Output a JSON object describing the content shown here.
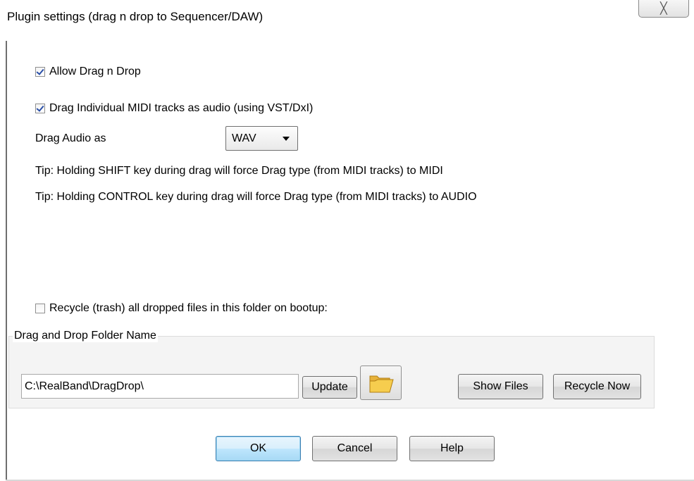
{
  "window": {
    "title": "Plugin settings (drag n drop to Sequencer/DAW)",
    "close_glyph": "╳"
  },
  "options": {
    "allow_drag": {
      "label": "Allow Drag n Drop",
      "checked": true
    },
    "drag_midi_audio": {
      "label": "Drag Individual MIDI tracks as audio (using VST/DxI)",
      "checked": true
    },
    "drag_audio_as_label": "Drag Audio as",
    "drag_audio_as_value": "WAV",
    "tip_shift": "Tip: Holding SHIFT key during drag will force Drag type (from MIDI tracks) to MIDI",
    "tip_control": "Tip: Holding CONTROL key during drag will force Drag type (from MIDI tracks) to AUDIO",
    "recycle": {
      "label": "Recycle (trash) all dropped files in this folder on bootup:",
      "checked": false
    }
  },
  "folder_group": {
    "title": "Drag and Drop Folder Name",
    "path_value": "C:\\RealBand\\DragDrop\\",
    "update_label": "Update",
    "show_files_label": "Show Files",
    "recycle_now_label": "Recycle Now"
  },
  "footer": {
    "ok_label": "OK",
    "cancel_label": "Cancel",
    "help_label": "Help"
  },
  "icons": {
    "folder": "folder-icon",
    "close": "close-icon",
    "dropdown": "chevron-down-icon"
  }
}
